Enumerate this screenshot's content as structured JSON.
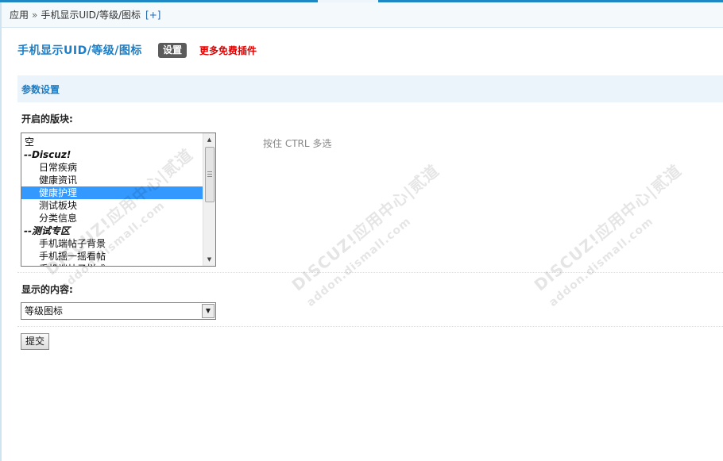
{
  "breadcrumb": {
    "root": "应用",
    "separator": "»",
    "current": "手机显示UID/等级/图标",
    "add_label": "[+]"
  },
  "header": {
    "title": "手机显示UID/等级/图标",
    "settings_tab": "设置",
    "more_plugins": "更多免费插件"
  },
  "section": {
    "title": "参数设置"
  },
  "forums_field": {
    "label": "开启的版块:",
    "hint": "按住 CTRL 多选",
    "options": [
      {
        "label": "空",
        "kind": "top"
      },
      {
        "label": "--Discuz!",
        "kind": "group"
      },
      {
        "label": "日常疾病",
        "kind": "child"
      },
      {
        "label": "健康资讯",
        "kind": "child"
      },
      {
        "label": "健康护理",
        "kind": "child",
        "selected": true
      },
      {
        "label": "测试板块",
        "kind": "child"
      },
      {
        "label": "分类信息",
        "kind": "child"
      },
      {
        "label": "--测试专区",
        "kind": "group"
      },
      {
        "label": "手机端帖子背景",
        "kind": "child"
      },
      {
        "label": "手机摇一摇看帖",
        "kind": "child"
      },
      {
        "label": "手机端帖子样式",
        "kind": "child"
      }
    ]
  },
  "content_field": {
    "label": "显示的内容:",
    "selected": "等级图标"
  },
  "submit_label": "提交",
  "watermark_text": "DISCUZ!应用中心|贰道",
  "watermark_sub": "addon.dismall.com",
  "colors": {
    "accent": "#1a7ec8",
    "top_line": "#1d88c4",
    "section_bg": "#ecf4fb",
    "promo_red": "#e00000",
    "selection": "#3399ff"
  }
}
